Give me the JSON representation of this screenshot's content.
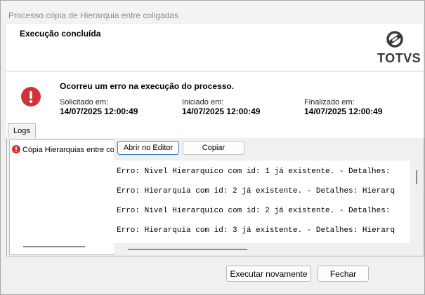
{
  "window": {
    "title": "Processo cópia de Hierarquia entre coligadas"
  },
  "header": {
    "title": "Execução concluída",
    "logo_text": "TOTVS",
    "logo_icon": "totvs-logo-icon"
  },
  "info": {
    "message": "Ocorreu um erro na execução do processo.",
    "requested_label": "Solicitado em:",
    "requested_value": "14/07/2025 12:00:49",
    "started_label": "Iniciado em:",
    "started_value": "14/07/2025 12:00:49",
    "finished_label": "Finalizado em:",
    "finished_value": "14/07/2025 12:00:49",
    "status_icon": "error-icon",
    "error_color": "#d13438"
  },
  "tabs": [
    {
      "label": "Logs"
    }
  ],
  "logs": {
    "items": [
      {
        "label": "Cópia Hierarquias entre coligadas",
        "icon": "error-icon"
      }
    ],
    "open_editor_label": "Abrir no Editor",
    "copy_label": "Copiar",
    "lines": [
      "Erro: Nivel Hierarquico com id: 1 já existente. - Detalhes: ",
      "Erro: Hierarquia com id: 2 já existente. - Detalhes: Hierarq",
      "Erro: Nivel Hierarquico com id: 2 já existente. - Detalhes: ",
      "Erro: Hierarquia com id: 3 já existente. - Detalhes: Hierarq"
    ]
  },
  "footer": {
    "run_again_label": "Executar novamente",
    "close_label": "Fechar"
  }
}
